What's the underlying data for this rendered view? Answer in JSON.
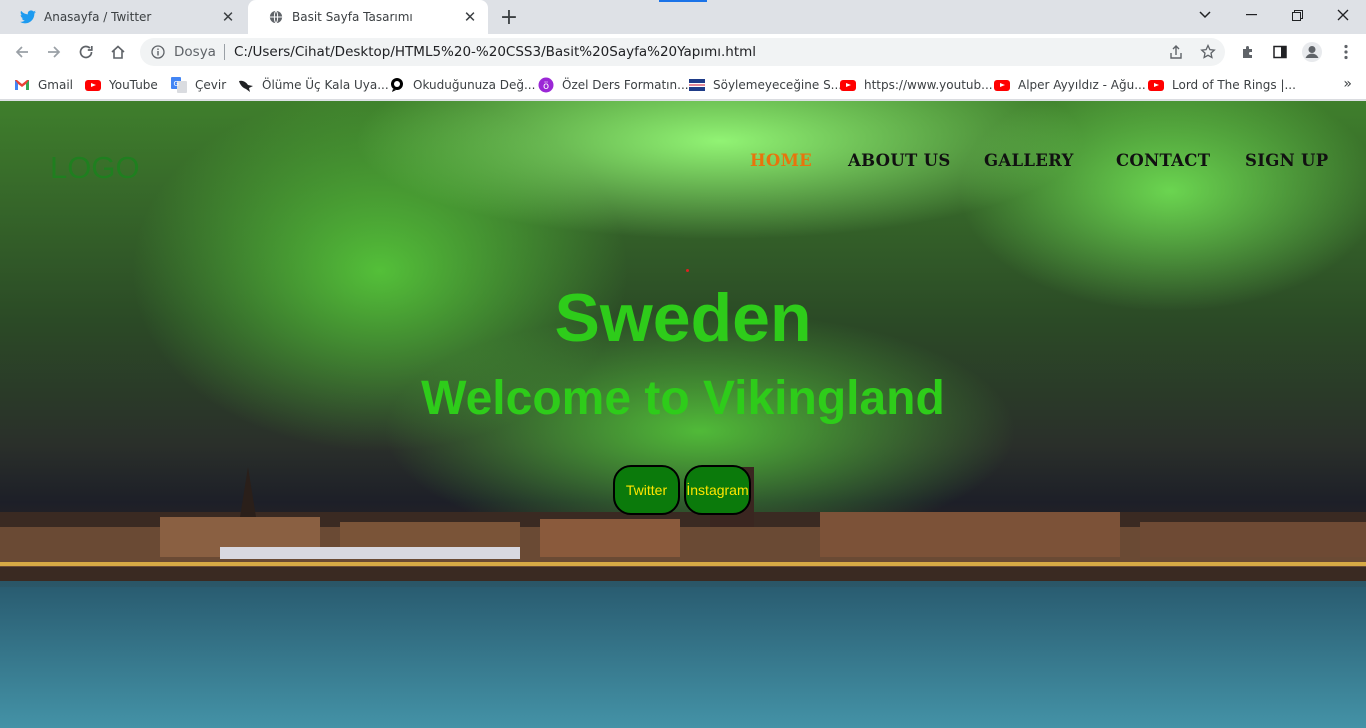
{
  "browser": {
    "tabs": [
      {
        "title": "Anasayfa / Twitter",
        "favicon": "twitter-bird-icon",
        "active": false
      },
      {
        "title": "Basit Sayfa Tasarımı",
        "favicon": "globe-icon",
        "active": true
      }
    ],
    "new_tab": "+",
    "address": {
      "scheme_label": "Dosya",
      "url": "C:/Users/Cihat/Desktop/HTML5%20-%20CSS3/Basit%20Sayfa%20Yapımı.html"
    },
    "bookmarks": [
      {
        "label": "Gmail",
        "icon": "gmail-icon"
      },
      {
        "label": "YouTube",
        "icon": "youtube-icon"
      },
      {
        "label": "Çevir",
        "icon": "translate-icon"
      },
      {
        "label": "Ölüme Üç Kala Uya...",
        "icon": "bird-icon"
      },
      {
        "label": "Okuduğunuza Değ...",
        "icon": "speech-bubble-icon"
      },
      {
        "label": "Özel Ders Formatın...",
        "icon": "purple-circle-icon"
      },
      {
        "label": "Söylemeyeceğine S...",
        "icon": "flag-icon"
      },
      {
        "label": "https://www.youtub...",
        "icon": "youtube-icon"
      },
      {
        "label": "Alper Ayyıldız - Ağu...",
        "icon": "youtube-icon"
      },
      {
        "label": "Lord of The Rings |...",
        "icon": "youtube-icon"
      }
    ],
    "bookmarks_more": "»"
  },
  "site": {
    "logo": "LOGO",
    "nav": [
      {
        "label": "HOME",
        "active": true
      },
      {
        "label": "ABOUT US",
        "active": false
      },
      {
        "label": "GALLERY",
        "active": false
      },
      {
        "label": "CONTACT",
        "active": false
      },
      {
        "label": "SIGN UP",
        "active": false
      }
    ],
    "hero_title": "Sweden",
    "hero_subtitle": "Welcome to Vikingland",
    "buttons": [
      {
        "label": "Twitter"
      },
      {
        "label": "İnstagram"
      }
    ],
    "colors": {
      "hero_text": "#2ecc1a",
      "nav_active": "#e8740c",
      "button_bg": "#0b7a0b",
      "button_text": "#ffe600"
    }
  }
}
